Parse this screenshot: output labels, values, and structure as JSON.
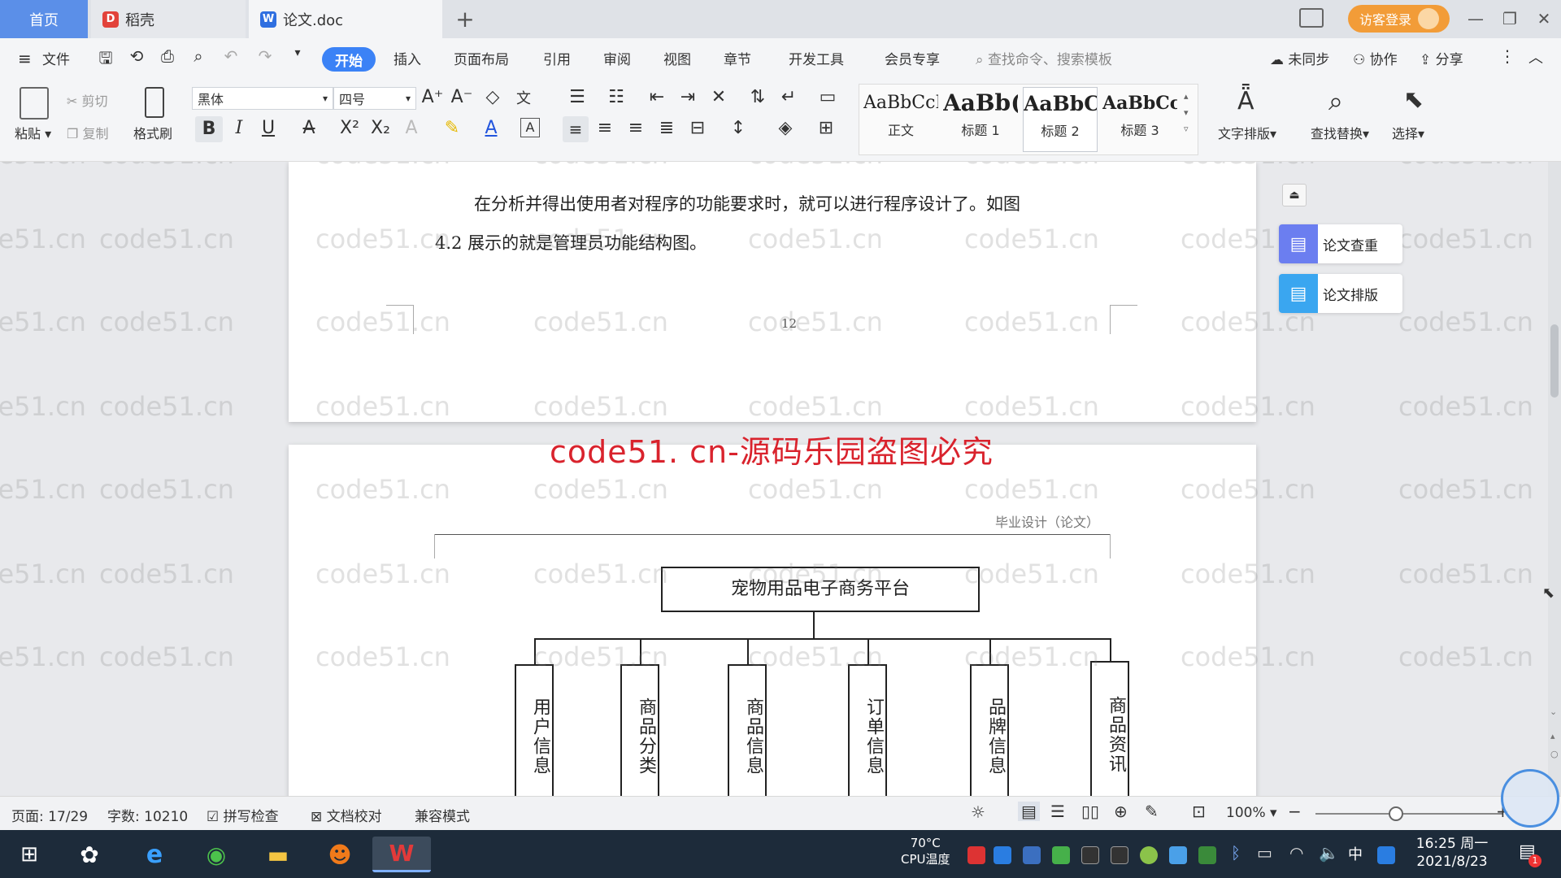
{
  "tabs": {
    "home": "首页",
    "daoke": "稻壳",
    "doc": "论文.doc",
    "new_tab": "+"
  },
  "titlebar": {
    "login": "访客登录"
  },
  "menu": {
    "file": "文件",
    "items": [
      "开始",
      "插入",
      "页面布局",
      "引用",
      "审阅",
      "视图",
      "章节",
      "开发工具",
      "会员专享"
    ],
    "search_placeholder": "查找命令、搜索模板",
    "sync": "未同步",
    "collab": "协作",
    "share": "分享"
  },
  "ribbon": {
    "paste": "粘贴",
    "cut": "剪切",
    "copy": "复制",
    "format_painter": "格式刷",
    "font_name": "黑体",
    "font_size": "四号",
    "styles": [
      {
        "preview": "AaBbCcI",
        "name": "正文"
      },
      {
        "preview": "AaBb(",
        "name": "标题 1"
      },
      {
        "preview": "AaBbC",
        "name": "标题 2"
      },
      {
        "preview": "AaBbCcI",
        "name": "标题 3"
      }
    ],
    "text_layout": "文字排版",
    "find_replace": "查找替换",
    "select": "选择"
  },
  "document": {
    "paragraph_line1": "在分析并得出使用者对程序的功能要求时，就可以进行程序设计了。如图",
    "paragraph_line2": "4.2 展示的就是管理员功能结构图。",
    "page_number": "12",
    "header_right": "毕业设计（论文）",
    "banner": "code51. cn-源码乐园盗图必究",
    "watermark": "code51.cn",
    "chart_root": "宠物用品电子商务平台",
    "chart_children": [
      "用户信息",
      "商品分类",
      "商品信息",
      "订单信息",
      "品牌信息",
      "商品资讯"
    ]
  },
  "side_panel": {
    "check": "论文查重",
    "layout": "论文排版"
  },
  "status": {
    "page": "页面: 17/29",
    "words": "字数: 10210",
    "spell": "拼写检查",
    "proof": "文档校对",
    "compat": "兼容模式",
    "zoom": "100%"
  },
  "taskbar": {
    "cpu_temp": "70°C",
    "cpu_label": "CPU温度",
    "ime": "中",
    "time": "16:25 周一",
    "date": "2021/8/23"
  },
  "colors": {
    "accent": "#3b82f6",
    "banner_red": "#d9232d",
    "login_orange": "#f29c38",
    "taskbar": "#1d2b3a"
  }
}
